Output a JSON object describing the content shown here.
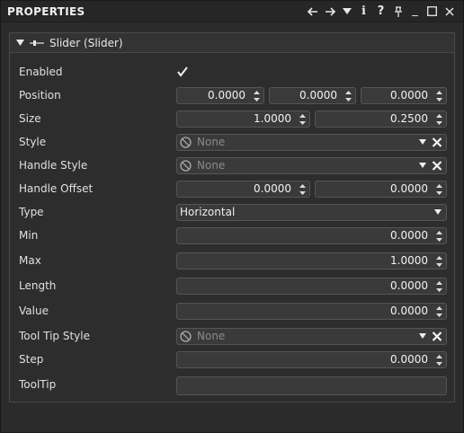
{
  "window": {
    "title": "PROPERTIES"
  },
  "toolbar": {
    "info_label": "i",
    "help_label": "?",
    "minimize_label": "_"
  },
  "component": {
    "title": "Slider (Slider)"
  },
  "rows": {
    "enabled": {
      "label": "Enabled",
      "checked": true
    },
    "position": {
      "label": "Position",
      "x": "0.0000",
      "y": "0.0000",
      "z": "0.0000"
    },
    "size": {
      "label": "Size",
      "w": "1.0000",
      "h": "0.2500"
    },
    "style": {
      "label": "Style",
      "value": "None"
    },
    "handle_style": {
      "label": "Handle Style",
      "value": "None"
    },
    "handle_offset": {
      "label": "Handle Offset",
      "x": "0.0000",
      "y": "0.0000"
    },
    "type": {
      "label": "Type",
      "value": "Horizontal"
    },
    "min": {
      "label": "Min",
      "value": "0.0000"
    },
    "max": {
      "label": "Max",
      "value": "1.0000"
    },
    "length": {
      "label": "Length",
      "value": "0.0000"
    },
    "value": {
      "label": "Value",
      "value": "0.0000"
    },
    "tooltip_style": {
      "label": "Tool Tip Style",
      "value": "None"
    },
    "step": {
      "label": "Step",
      "value": "0.0000"
    },
    "tooltip": {
      "label": "ToolTip",
      "value": ""
    }
  }
}
